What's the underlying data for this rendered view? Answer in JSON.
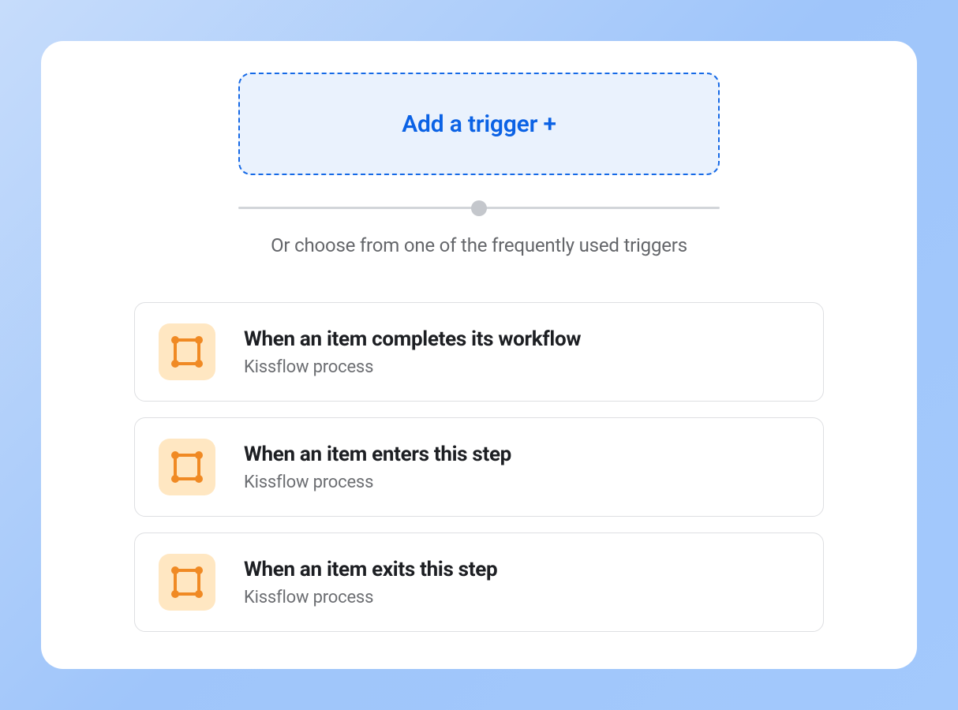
{
  "add_trigger_label": "Add a trigger +",
  "subtitle": "Or choose from one of the frequently used triggers",
  "triggers": [
    {
      "title": "When an item completes its workflow",
      "subtitle": "Kissflow process"
    },
    {
      "title": "When an item enters this step",
      "subtitle": "Kissflow process"
    },
    {
      "title": "When an item exits this step",
      "subtitle": "Kissflow process"
    }
  ]
}
